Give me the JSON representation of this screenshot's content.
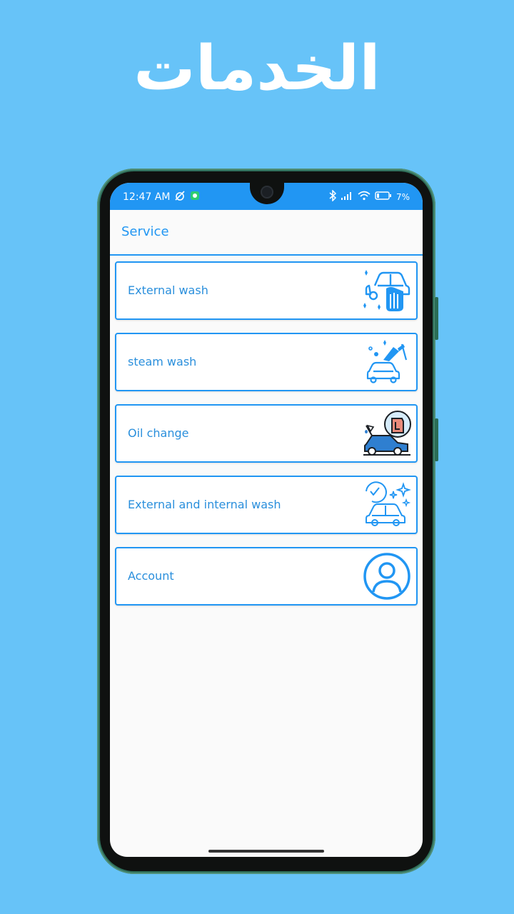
{
  "banner": {
    "title": "الخدمات"
  },
  "status_bar": {
    "time": "12:47 AM",
    "battery": "7%"
  },
  "toolbar": {
    "title": "Service"
  },
  "services": [
    {
      "label": "External wash",
      "icon": "car-wash-hand-icon"
    },
    {
      "label": "steam wash",
      "icon": "steam-wash-gun-icon"
    },
    {
      "label": "Oil change",
      "icon": "oil-change-car-icon"
    },
    {
      "label": "External and internal wash",
      "icon": "full-wash-sparkle-icon"
    },
    {
      "label": "Account",
      "icon": "account-user-icon"
    }
  ],
  "colors": {
    "background": "#67c3f8",
    "accent": "#2196f3",
    "label": "#2a8fdc",
    "oil_car": "#2f7fd0",
    "oil_can": "#e98b7b"
  }
}
